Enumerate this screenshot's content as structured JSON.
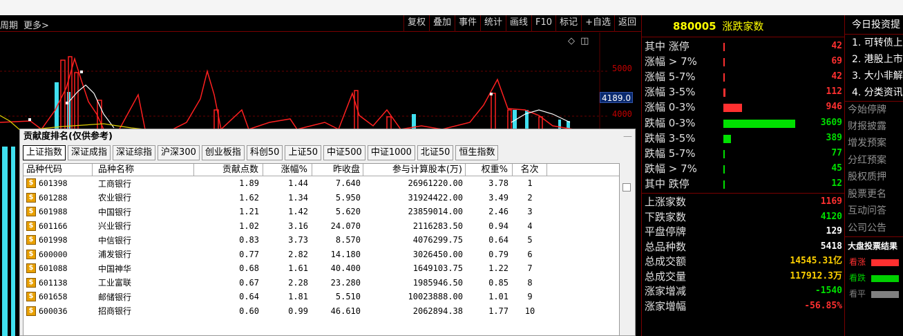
{
  "toolbar": {
    "left_items": [
      "周期",
      "更多>"
    ],
    "buttons": [
      "复权",
      "叠加",
      "事件",
      "统计",
      "画线",
      "F10",
      "标记",
      "+自选",
      "返回"
    ]
  },
  "chart": {
    "axis_labels": [
      "5000",
      "4000"
    ],
    "current_value": "4189.0",
    "icons": [
      "diamond-icon",
      "window-icon"
    ]
  },
  "panel": {
    "title": "贡献度排名(仅供参考)",
    "close": "—",
    "tabs": [
      "上证指数",
      "深证成指",
      "深证综指",
      "沪深300",
      "创业板指",
      "科创50",
      "上证50",
      "中证500",
      "中证1000",
      "北证50",
      "恒生指数"
    ],
    "active_tab": 0,
    "columns": [
      "品种代码",
      "品种名称",
      "贡献点数",
      "涨幅%",
      "昨收盘",
      "参与计算股本(万)",
      "权重%",
      "名次"
    ],
    "rows": [
      [
        "601398",
        "工商银行",
        "1.89",
        "1.44",
        "7.640",
        "26961220.00",
        "3.78",
        "1"
      ],
      [
        "601288",
        "农业银行",
        "1.62",
        "1.34",
        "5.950",
        "31924422.00",
        "3.49",
        "2"
      ],
      [
        "601988",
        "中国银行",
        "1.21",
        "1.42",
        "5.620",
        "23859014.00",
        "2.46",
        "3"
      ],
      [
        "601166",
        "兴业银行",
        "1.02",
        "3.16",
        "24.070",
        "2116283.50",
        "0.94",
        "4"
      ],
      [
        "601998",
        "中信银行",
        "0.83",
        "3.73",
        "8.570",
        "4076299.75",
        "0.64",
        "5"
      ],
      [
        "600000",
        "浦发银行",
        "0.77",
        "2.82",
        "14.180",
        "3026450.00",
        "0.79",
        "6"
      ],
      [
        "601088",
        "中国神华",
        "0.68",
        "1.61",
        "40.400",
        "1649103.75",
        "1.22",
        "7"
      ],
      [
        "601138",
        "工业富联",
        "0.67",
        "2.28",
        "23.280",
        "1985946.50",
        "0.85",
        "8"
      ],
      [
        "601658",
        "邮储银行",
        "0.64",
        "1.81",
        "5.510",
        "10023888.00",
        "1.01",
        "9"
      ],
      [
        "600036",
        "招商银行",
        "0.60",
        "0.99",
        "46.610",
        "2062894.38",
        "1.77",
        "10"
      ]
    ]
  },
  "stats": {
    "code": "880005",
    "name": "涨跌家数",
    "up_rows": [
      {
        "label": "其中 涨停",
        "value": "42",
        "frac": 0.011
      },
      {
        "label": "涨幅 > 7%",
        "value": "69",
        "frac": 0.019
      },
      {
        "label": "涨幅 5-7%",
        "value": "42",
        "frac": 0.011
      },
      {
        "label": "涨幅 3-5%",
        "value": "112",
        "frac": 0.031
      },
      {
        "label": "涨幅 0-3%",
        "value": "946",
        "frac": 0.262
      }
    ],
    "down_rows": [
      {
        "label": "跌幅 0-3%",
        "value": "3609",
        "frac": 1.0
      },
      {
        "label": "跌幅 3-5%",
        "value": "389",
        "frac": 0.108
      },
      {
        "label": "跌幅 5-7%",
        "value": "77",
        "frac": 0.021
      },
      {
        "label": "跌幅 > 7%",
        "value": "45",
        "frac": 0.012
      },
      {
        "label": "其中 跌停",
        "value": "12",
        "frac": 0.003
      }
    ],
    "summary": [
      {
        "label": "上涨家数",
        "value": "1169",
        "color": "red"
      },
      {
        "label": "下跌家数",
        "value": "4120",
        "color": "green"
      },
      {
        "label": "平盘停牌",
        "value": "129",
        "color": "white"
      },
      {
        "label": "总品种数",
        "value": "5418",
        "color": "white"
      },
      {
        "label": "总成交额",
        "value": "14545.31亿",
        "color": "yellow"
      },
      {
        "label": "总成交量",
        "value": "117912.3万",
        "color": "yellow"
      },
      {
        "label": "涨家增减",
        "value": "-1540",
        "color": "green"
      },
      {
        "label": "涨家增幅",
        "value": "-56.85%",
        "color": "red"
      }
    ]
  },
  "far": {
    "title": "今日投资提",
    "news": [
      "1. 可转债上",
      "2. 港股上市",
      "3. 大小非解",
      "4. 分类资讯"
    ],
    "categories": [
      "今始停牌",
      "财报披露",
      "增发预案",
      "分红预案",
      "股权质押",
      "股票更名",
      "互动问答",
      "公司公告"
    ],
    "vote_title": "大盘投票结果",
    "votes": [
      {
        "label": "看涨",
        "color": "#ff3030"
      },
      {
        "label": "看跌",
        "color": "#00d000"
      },
      {
        "label": "看平",
        "color": "#808080"
      }
    ]
  },
  "colors": {
    "up": "#ff3030",
    "down": "#00e000",
    "bar_cyan": "#40e0f0",
    "line_red": "#ff2020",
    "line_white": "#ffffff",
    "line_yellow": "#e0d000"
  }
}
